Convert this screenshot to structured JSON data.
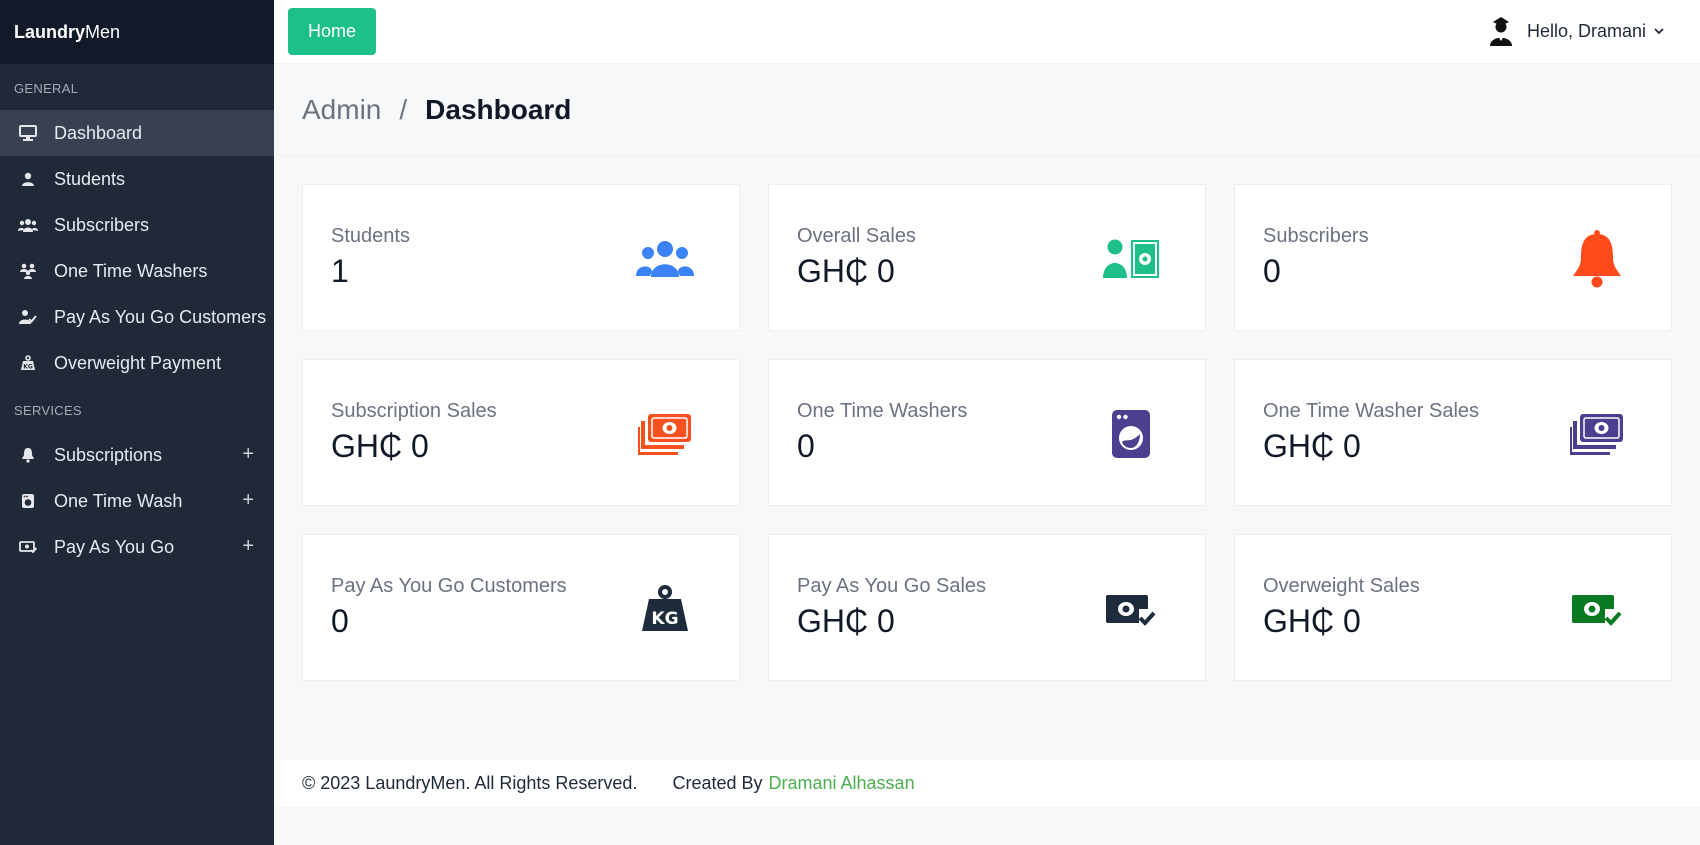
{
  "brand": {
    "bold": "Laundry",
    "light": "Men"
  },
  "sidebar": {
    "general_title": "GENERAL",
    "general_items": [
      {
        "label": "Dashboard",
        "icon": "monitor-icon",
        "active": true
      },
      {
        "label": "Students",
        "icon": "user-icon"
      },
      {
        "label": "Subscribers",
        "icon": "users-icon"
      },
      {
        "label": "One Time Washers",
        "icon": "user-group-icon"
      },
      {
        "label": "Pay As You Go Customers",
        "icon": "user-check-icon"
      },
      {
        "label": "Overweight Payment",
        "icon": "weight-icon"
      }
    ],
    "services_title": "SERVICES",
    "services_items": [
      {
        "label": "Subscriptions",
        "icon": "bell-icon",
        "expand": "+"
      },
      {
        "label": "One Time Wash",
        "icon": "washer-icon",
        "expand": "+"
      },
      {
        "label": "Pay As You Go",
        "icon": "money-icon",
        "expand": "+"
      }
    ]
  },
  "topbar": {
    "home_label": "Home",
    "greeting": "Hello, Dramani",
    "caret": "⌄"
  },
  "breadcrumb": {
    "parent": "Admin",
    "separator": "/",
    "current": "Dashboard"
  },
  "cards": [
    {
      "label": "Students",
      "value": "1",
      "icon": "users-icon",
      "color": "#3b82f6"
    },
    {
      "label": "Overall Sales",
      "value": "GH₵ 0",
      "icon": "user-money-icon",
      "color": "#1dbf8a"
    },
    {
      "label": "Subscribers",
      "value": "0",
      "icon": "bell-icon",
      "color": "#ff4a1c"
    },
    {
      "label": "Subscription Sales",
      "value": "GH₵ 0",
      "icon": "money-stack-icon",
      "color": "#f4511e"
    },
    {
      "label": "One Time Washers",
      "value": "0",
      "icon": "washer-icon",
      "color": "#4b3f8f"
    },
    {
      "label": "One Time Washer Sales",
      "value": "GH₵ 0",
      "icon": "money-stack-icon",
      "color": "#4b3f8f"
    },
    {
      "label": "Pay As You Go Customers",
      "value": "0",
      "icon": "kg-weight-icon",
      "color": "#1e2b3c"
    },
    {
      "label": "Pay As You Go Sales",
      "value": "GH₵ 0",
      "icon": "money-check-icon",
      "color": "#1e2b3c"
    },
    {
      "label": "Overweight Sales",
      "value": "GH₵ 0",
      "icon": "money-check-icon",
      "color": "#0a7a22"
    }
  ],
  "footer": {
    "copyright": "© 2023 LaundryMen. All Rights Reserved.",
    "created_by": "Created By",
    "author": "Dramani Alhassan"
  }
}
